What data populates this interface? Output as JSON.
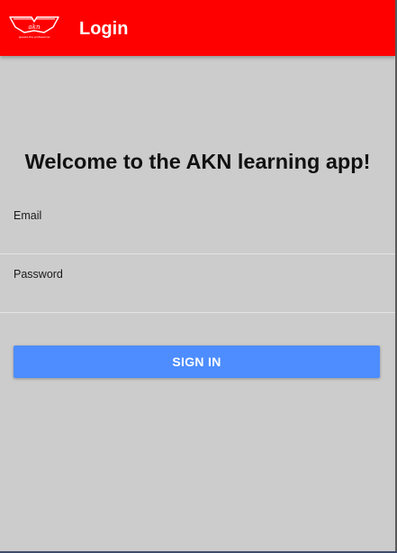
{
  "app": {
    "title": "Login"
  },
  "logo": {
    "text": "akn",
    "tagline": "speaks the professions"
  },
  "welcome": {
    "heading": "Welcome to the AKN learning app!"
  },
  "form": {
    "email": {
      "label": "Email",
      "value": "",
      "placeholder": ""
    },
    "password": {
      "label": "Password",
      "value": "",
      "placeholder": ""
    },
    "submit_label": "SIGN IN"
  },
  "colors": {
    "header": "#ff0000",
    "background": "#cccccc",
    "button": "#4d8dff",
    "button_text": "#ffffff"
  }
}
